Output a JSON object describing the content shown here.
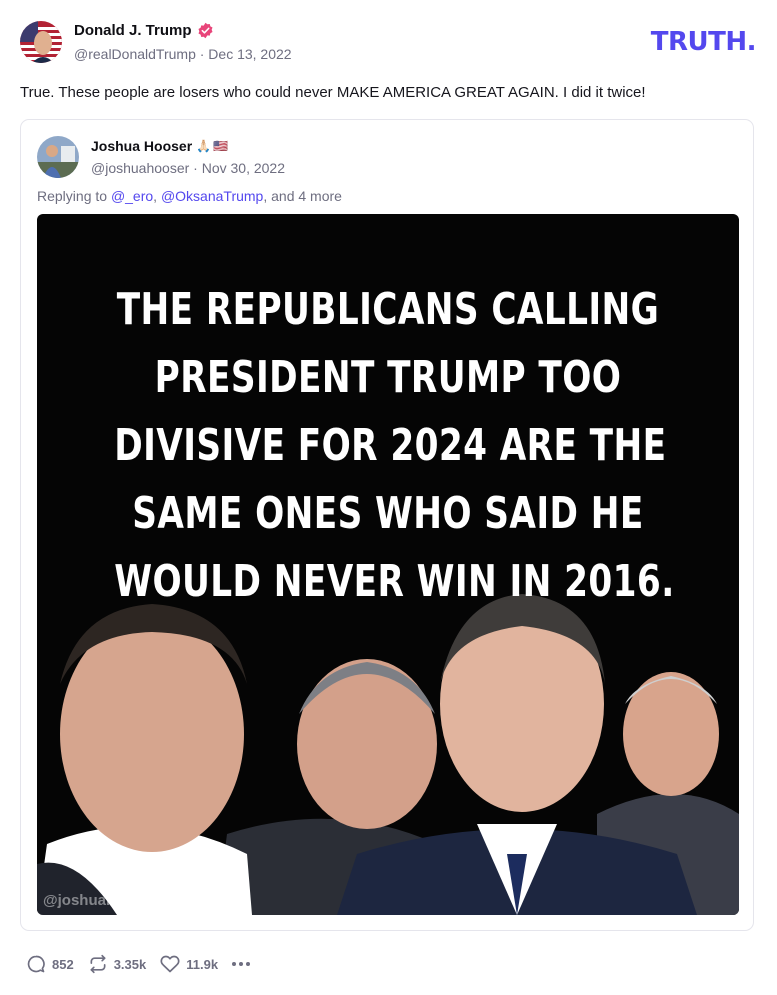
{
  "post": {
    "author_name": "Donald J. Trump",
    "handle_date": "@realDonaldTrump · Dec 13, 2022",
    "text": "True. These people are losers who could never MAKE AMERICA GREAT AGAIN. I did it twice!",
    "verified_icon": "verified-badge-icon"
  },
  "brand": {
    "logo_text": "TRUTH",
    "logo_dot": ".",
    "accent": "#5448ee"
  },
  "quote": {
    "author_name": "Joshua Hooser",
    "emoji": [
      "🙏🏻",
      "🇺🇸"
    ],
    "handle_date": "@joshuahooser · Nov 30, 2022",
    "reply_prefix": "Replying to ",
    "reply_user1": "@_ero",
    "reply_sep": ", ",
    "reply_user2": "@OksanaTrump",
    "reply_suffix": ", and 4 more",
    "image": {
      "lines": [
        "THE REPUBLICANS CALLING",
        "PRESIDENT TRUMP TOO",
        "DIVISIVE FOR 2024 ARE THE",
        "SAME ONES WHO SAID HE",
        "WOULD NEVER WIN IN 2016."
      ],
      "watermark": "@joshuahooser"
    }
  },
  "actions": {
    "replies": "852",
    "retruths": "3.35k",
    "likes": "11.9k"
  }
}
